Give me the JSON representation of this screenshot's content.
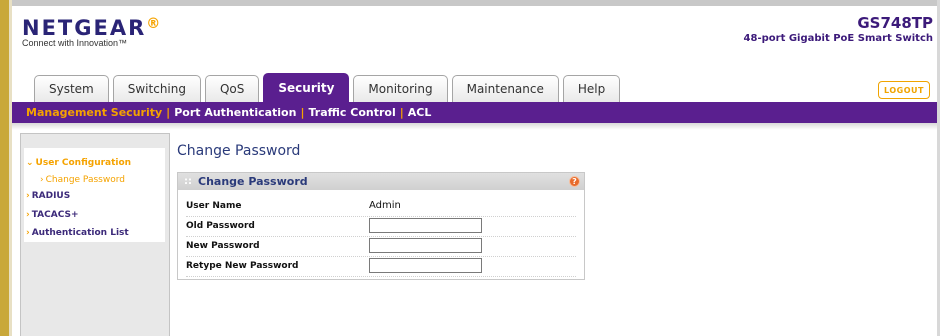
{
  "brand": {
    "logo": "NETGEAR",
    "tagline": "Connect with Innovation™"
  },
  "product": {
    "model": "GS748TP",
    "description": "48-port Gigabit PoE Smart Switch"
  },
  "tabs": [
    {
      "label": "System",
      "active": false
    },
    {
      "label": "Switching",
      "active": false
    },
    {
      "label": "QoS",
      "active": false
    },
    {
      "label": "Security",
      "active": true
    },
    {
      "label": "Monitoring",
      "active": false
    },
    {
      "label": "Maintenance",
      "active": false
    },
    {
      "label": "Help",
      "active": false
    }
  ],
  "logout_label": "LOGOUT",
  "subnav": [
    {
      "label": "Management Security",
      "active": true
    },
    {
      "label": "Port Authentication",
      "active": false
    },
    {
      "label": "Traffic Control",
      "active": false
    },
    {
      "label": "ACL",
      "active": false
    }
  ],
  "sidebar": {
    "items": [
      {
        "label": "User Configuration",
        "state": "expanded"
      },
      {
        "label": "Change Password",
        "state": "selected-sub"
      },
      {
        "label": "RADIUS",
        "state": "collapsed"
      },
      {
        "label": "TACACS+",
        "state": "collapsed"
      },
      {
        "label": "Authentication List",
        "state": "collapsed"
      }
    ]
  },
  "page_title": "Change Password",
  "form": {
    "title": "Change Password",
    "help_glyph": "?",
    "fields": [
      {
        "label": "User Name",
        "value": "Admin"
      },
      {
        "label": "Old Password",
        "value": ""
      },
      {
        "label": "New Password",
        "value": ""
      },
      {
        "label": "Retype New Password",
        "value": ""
      }
    ]
  },
  "colors": {
    "accent_purple": "#5a1f8f",
    "accent_orange": "#f5a300",
    "brand_navy": "#2a2476"
  }
}
